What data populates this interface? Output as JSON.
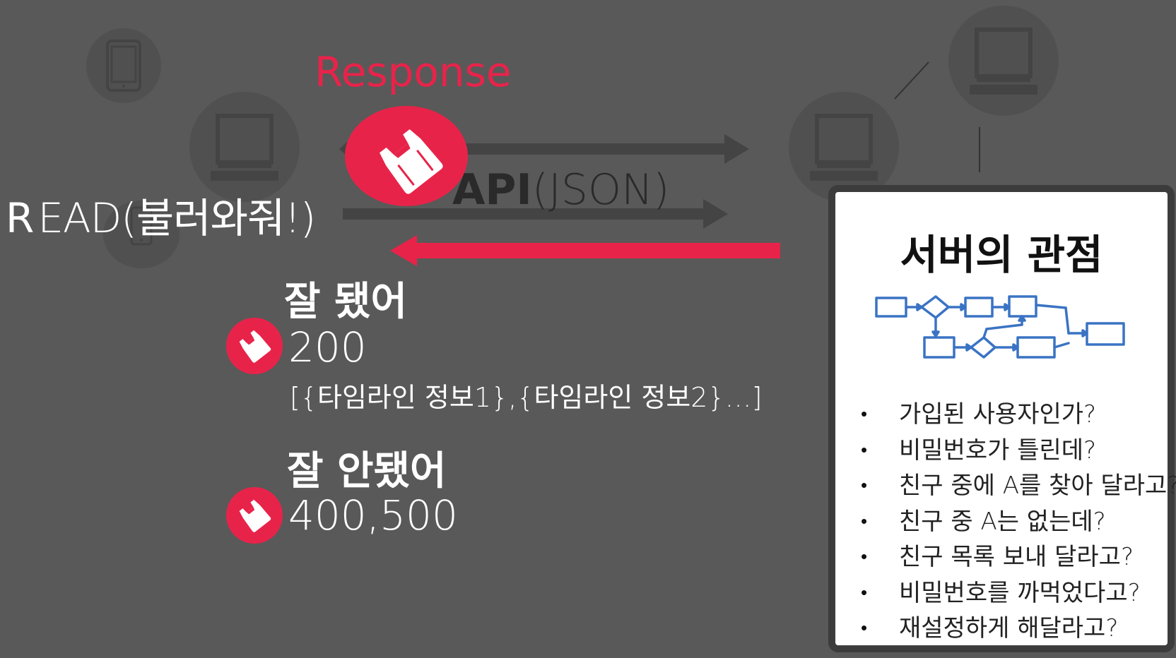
{
  "colors": {
    "background": "#595959",
    "accent": "#e8234a",
    "device_bg": "#505050",
    "device_icon": "#444444",
    "card_bg": "#ffffff",
    "flowchart": "#3a73c4"
  },
  "icons": {
    "devices": [
      "tablet-icon",
      "desktop-icon",
      "phone-icon",
      "server-icon",
      "server-icon"
    ],
    "response_badge": "plastic-bag-icon"
  },
  "diagram": {
    "response_label": "Response",
    "api_label_bold": "API",
    "api_label_rest": "(JSON)",
    "read_label_r": "R",
    "read_label_rest": "EAD(불러와줘!)"
  },
  "responses": [
    {
      "title": "잘 됐어",
      "code": "200",
      "payload": "[{타임라인 정보1},{타임라인 정보2}…]"
    },
    {
      "title": "잘 안됐어",
      "code": "400,500"
    }
  ],
  "server_card": {
    "title": "서버의 관점",
    "questions": [
      "가입된 사용자인가?",
      "비밀번호가 틀린데?",
      "친구 중에 A를 찾아 달라고?",
      "친구 중 A는 없는데?",
      "친구 목록 보내 달라고?",
      "비밀번호를 까먹었다고?",
      "재설정하게 해달라고?"
    ]
  }
}
